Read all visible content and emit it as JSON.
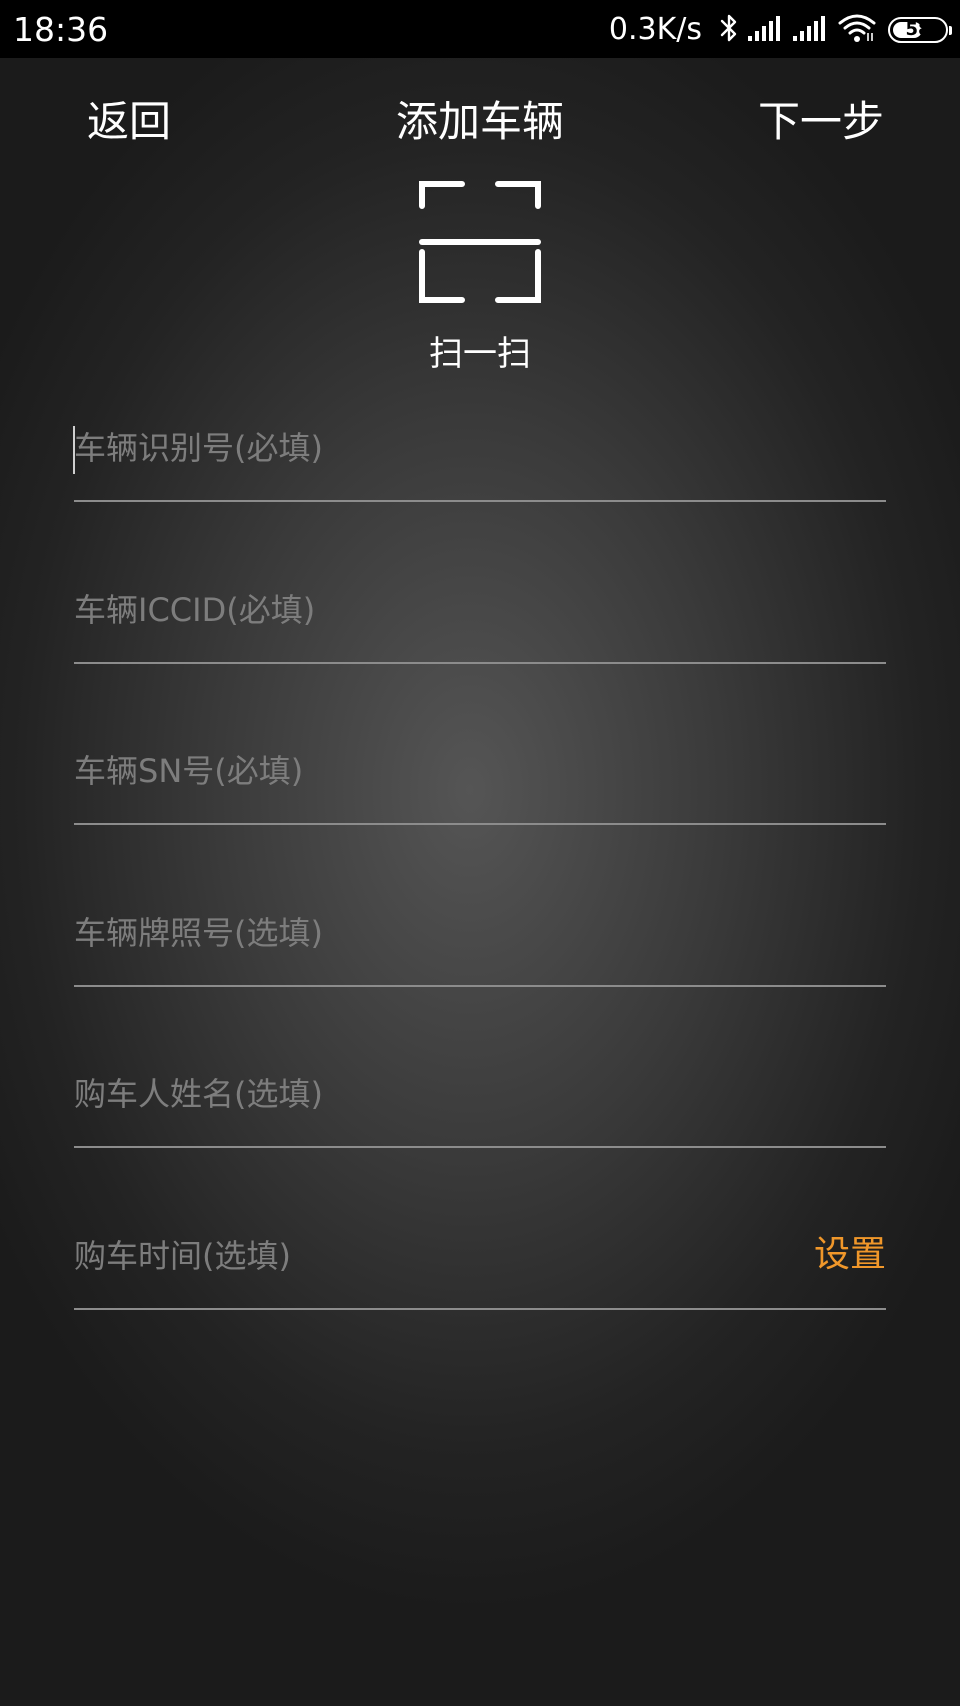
{
  "status_bar": {
    "time": "18:36",
    "net_speed": "0.3K/s",
    "battery": "58",
    "battery_level": 0.58,
    "icons": [
      "bluetooth-icon",
      "signal-icon",
      "signal-icon",
      "wifi-icon",
      "battery-icon"
    ]
  },
  "nav": {
    "back": "返回",
    "title": "添加车辆",
    "next": "下一步"
  },
  "scan": {
    "icon": "scan-icon",
    "label": "扫一扫"
  },
  "form": {
    "fields": [
      {
        "placeholder": "车辆识别号(必填)",
        "value": ""
      },
      {
        "placeholder": "车辆ICCID(必填)",
        "value": ""
      },
      {
        "placeholder": "车辆SN号(必填)",
        "value": ""
      },
      {
        "placeholder": "车辆牌照号(选填)",
        "value": ""
      },
      {
        "placeholder": "购车人姓名(选填)",
        "value": ""
      },
      {
        "placeholder": "购车时间(选填)",
        "value": "",
        "action": "设置"
      }
    ]
  },
  "colors": {
    "accent": "#f0972a",
    "text": "#ffffff",
    "placeholder": "#7d7d7d",
    "divider": "#8c8c8c",
    "status_bar_bg": "#000000"
  }
}
